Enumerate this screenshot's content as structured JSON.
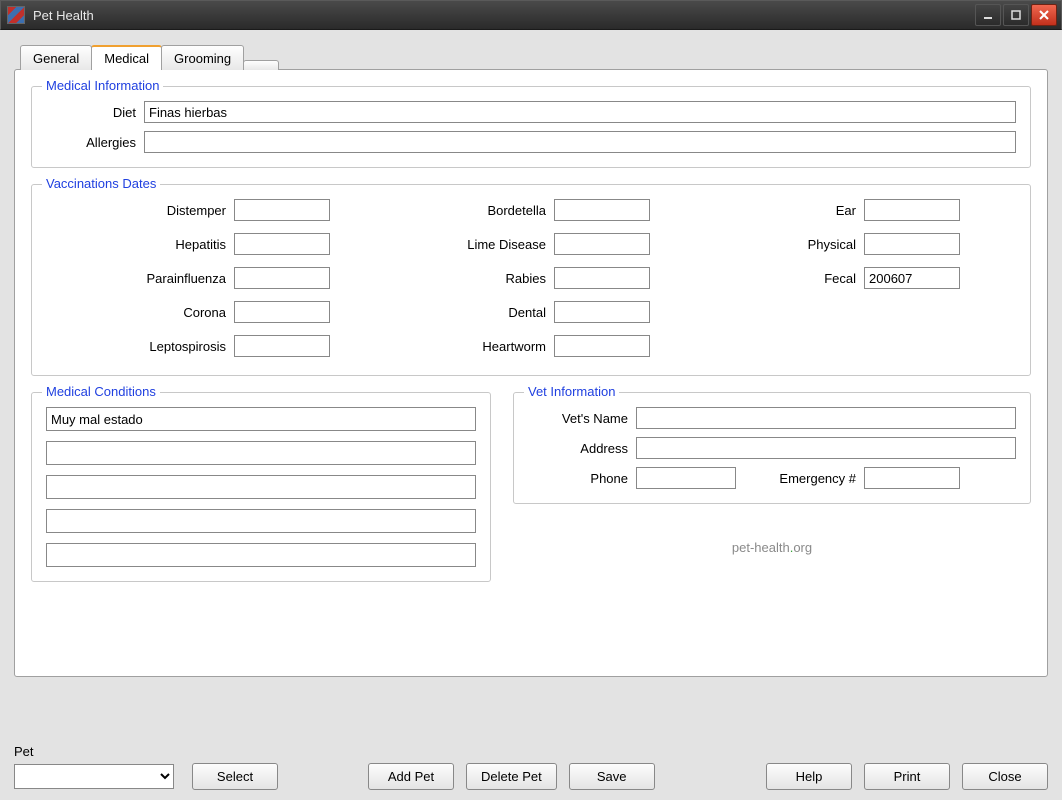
{
  "window": {
    "title": "Pet Health"
  },
  "tabs": {
    "general": "General",
    "medical": "Medical",
    "grooming": "Grooming"
  },
  "medicalInfo": {
    "legend": "Medical Information",
    "dietLabel": "Diet",
    "dietValue": "Finas hierbas",
    "allergiesLabel": "Allergies",
    "allergiesValue": ""
  },
  "vaccinations": {
    "legend": "Vaccinations Dates",
    "col1": [
      {
        "label": "Distemper",
        "value": ""
      },
      {
        "label": "Hepatitis",
        "value": ""
      },
      {
        "label": "Parainfluenza",
        "value": ""
      },
      {
        "label": "Corona",
        "value": ""
      },
      {
        "label": "Leptospirosis",
        "value": ""
      }
    ],
    "col2": [
      {
        "label": "Bordetella",
        "value": ""
      },
      {
        "label": "Lime Disease",
        "value": ""
      },
      {
        "label": "Rabies",
        "value": ""
      },
      {
        "label": "Dental",
        "value": ""
      },
      {
        "label": "Heartworm",
        "value": ""
      }
    ],
    "col3": [
      {
        "label": "Ear",
        "value": ""
      },
      {
        "label": "Physical",
        "value": ""
      },
      {
        "label": "Fecal",
        "value": "200607"
      }
    ]
  },
  "medicalConditions": {
    "legend": "Medical Conditions",
    "items": [
      "Muy mal estado",
      "",
      "",
      "",
      ""
    ]
  },
  "vetInfo": {
    "legend": "Vet Information",
    "nameLabel": "Vet's Name",
    "nameValue": "",
    "addressLabel": "Address",
    "addressValue": "",
    "phoneLabel": "Phone",
    "phoneValue": "",
    "emergencyLabel": "Emergency #",
    "emergencyValue": ""
  },
  "logo": {
    "part1": "pet",
    "dash": "-",
    "part2": "health",
    "dot": ".",
    "part3": "org"
  },
  "bottom": {
    "petLabel": "Pet",
    "petSelected": "",
    "buttons": {
      "select": "Select",
      "addPet": "Add Pet",
      "deletePet": "Delete Pet",
      "save": "Save",
      "help": "Help",
      "print": "Print",
      "close": "Close"
    }
  }
}
